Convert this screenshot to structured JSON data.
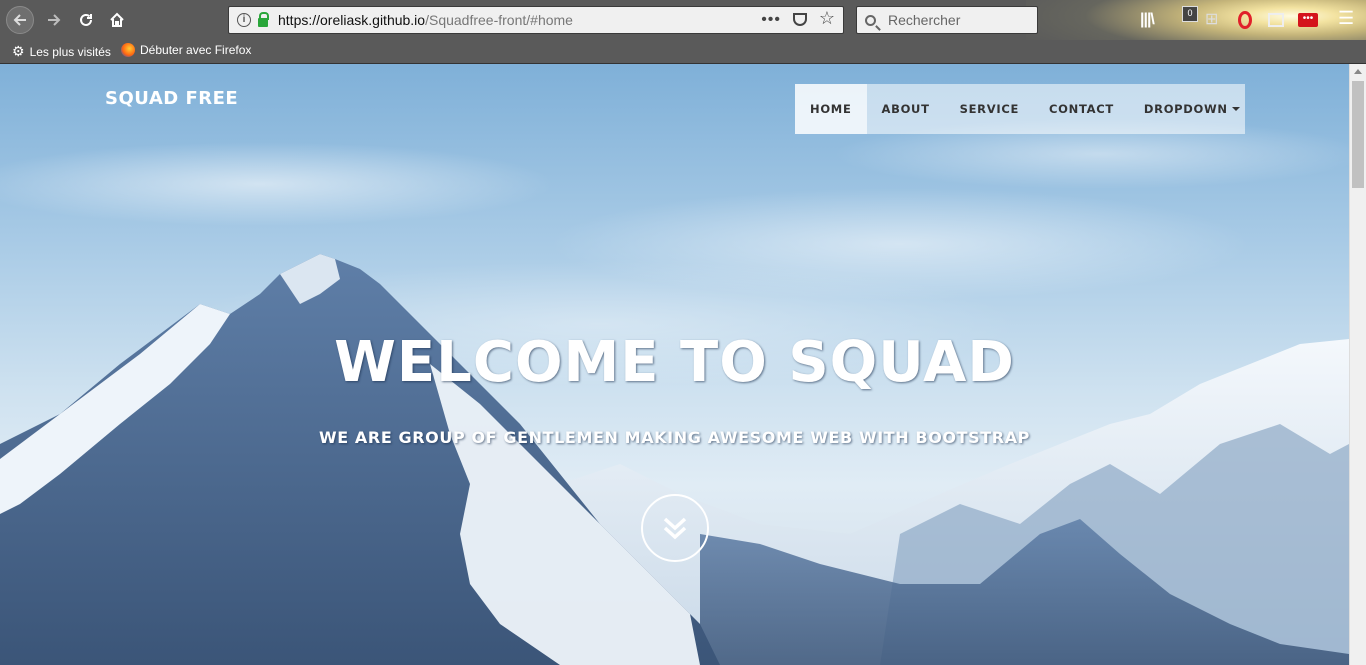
{
  "browser": {
    "url_host": "https://oreliask.github.io",
    "url_path": "/Squadfree-front/#home",
    "url_actions_label": "•••",
    "search_placeholder": "Rechercher",
    "counter_badge": "0",
    "bookmarks": [
      {
        "label": "Les plus visités",
        "icon": "gear-icon"
      },
      {
        "label": "Débuter avec Firefox",
        "icon": "firefox-icon"
      }
    ]
  },
  "site": {
    "brand": "SQUAD FREE",
    "nav": [
      {
        "label": "HOME",
        "active": true
      },
      {
        "label": "ABOUT",
        "active": false
      },
      {
        "label": "SERVICE",
        "active": false
      },
      {
        "label": "CONTACT",
        "active": false
      },
      {
        "label": "DROPDOWN",
        "active": false,
        "has_caret": true
      }
    ],
    "hero_title": "WELCOME TO SQUAD",
    "hero_subtitle": "WE ARE GROUP OF GENTLEMEN MAKING AWESOME WEB WITH BOOTSTRAP",
    "scroll_icon": "double-chevron-down-icon"
  },
  "colors": {
    "chrome": "#5a5a5a",
    "accent_lock": "#2aa63a",
    "nav_text": "#333333"
  }
}
